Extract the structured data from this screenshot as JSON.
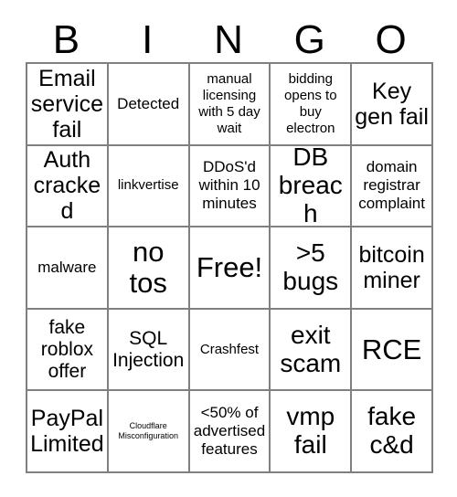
{
  "card": {
    "header_letters": [
      "B",
      "I",
      "N",
      "G",
      "O"
    ],
    "rows": [
      [
        {
          "text": "Email service fail",
          "size": "fs-2xl"
        },
        {
          "text": "Detected",
          "size": "fs-lg"
        },
        {
          "text": "manual licensing with 5 day wait",
          "size": "fs-md"
        },
        {
          "text": "bidding opens to buy electron",
          "size": "fs-md"
        },
        {
          "text": "Key gen fail",
          "size": "fs-2xl"
        }
      ],
      [
        {
          "text": "Auth cracked",
          "size": "fs-2xl"
        },
        {
          "text": "linkvertise",
          "size": "fs-md"
        },
        {
          "text": "DDoS'd within 10 minutes",
          "size": "fs-lg"
        },
        {
          "text": "DB breach",
          "size": "fs-3xl"
        },
        {
          "text": "domain registrar complaint",
          "size": "fs-lg"
        }
      ],
      [
        {
          "text": "malware",
          "size": "fs-lg"
        },
        {
          "text": "no tos",
          "size": "fs-4xl"
        },
        {
          "text": "Free!",
          "size": "fs-4xl"
        },
        {
          "text": ">5 bugs",
          "size": "fs-3xl"
        },
        {
          "text": "bitcoin miner",
          "size": "fs-2xl"
        }
      ],
      [
        {
          "text": "fake roblox offer",
          "size": "fs-xl"
        },
        {
          "text": "SQL Injection",
          "size": "fs-xl"
        },
        {
          "text": "Crashfest",
          "size": "fs-md"
        },
        {
          "text": "exit scam",
          "size": "fs-3xl"
        },
        {
          "text": "RCE",
          "size": "fs-4xl"
        }
      ],
      [
        {
          "text": "PayPal Limited",
          "size": "fs-2xl"
        },
        {
          "text": "Cloudflare Misconfiguration",
          "size": "fs-xs"
        },
        {
          "text": "<50% of advertised features",
          "size": "fs-lg"
        },
        {
          "text": "vmp fail",
          "size": "fs-3xl"
        },
        {
          "text": "fake c&d",
          "size": "fs-3xl"
        }
      ]
    ]
  },
  "colors": {
    "text": "#000000",
    "border": "#808080",
    "background": "#ffffff"
  }
}
